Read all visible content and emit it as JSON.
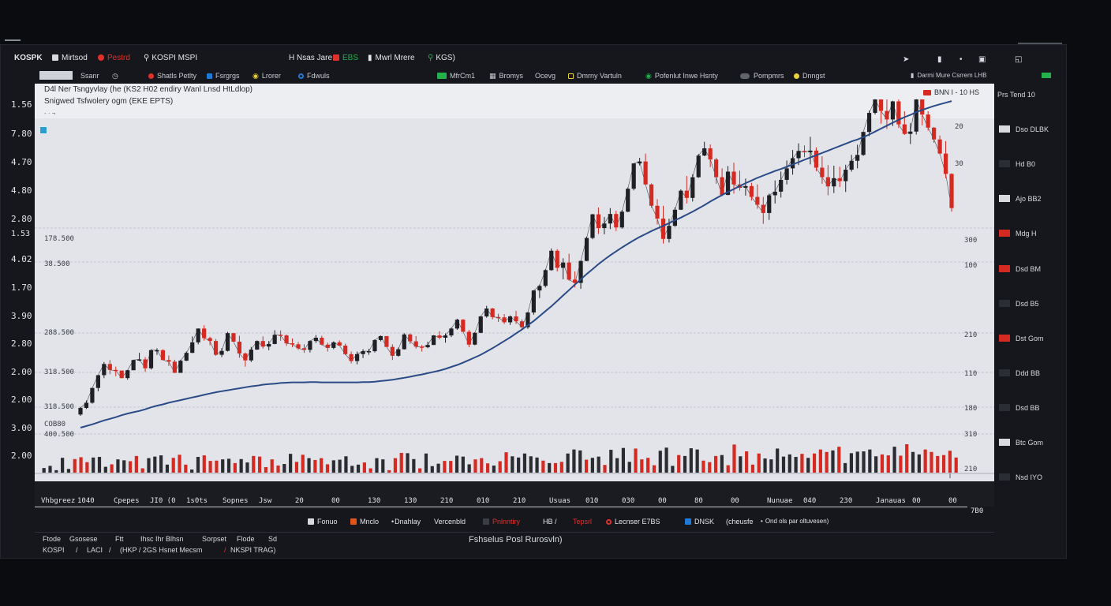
{
  "colors": {
    "up": "#1e2024",
    "down": "#d42a22",
    "ma": "#2b4a86",
    "panel": "#e2e4e9",
    "accent_green": "#22b14c",
    "accent_blue": "#1e7ad6"
  },
  "topbar": {
    "symbol": "KOSPK",
    "items": [
      {
        "label": "Mirtsod",
        "icon": "square-icon",
        "color": "#d6d9de"
      },
      {
        "label": "Pestrd",
        "icon": "record-dot-icon",
        "color": "#e0302a"
      },
      {
        "label": "KOSPI MSPI",
        "icon": "search-icon",
        "color": "#d6d9de"
      },
      {
        "label": "H Nsas Jare",
        "icon": "",
        "color": "#d6d9de"
      },
      {
        "label": "EBS",
        "icon": "red-square-icon",
        "color": "#22b14c"
      },
      {
        "label": "Mwrl Mrere",
        "icon": "candle-icon",
        "color": "#d6d9de"
      },
      {
        "label": "KGS)",
        "icon": "search-icon",
        "color": "#d6d9de"
      }
    ]
  },
  "toolbar": {
    "items": [
      {
        "label": "Ssanr",
        "icon": "",
        "color": "#c9ccd3"
      },
      {
        "label": "Shatls Petlty",
        "icon": "record-dot-icon",
        "color": "#e0302a"
      },
      {
        "label": "Fsrgrgs",
        "icon": "blue-square-icon",
        "color": "#1e7ad6"
      },
      {
        "label": "Lrorer",
        "icon": "eye-icon",
        "color": "#e8d23a"
      },
      {
        "label": "Fdwuls",
        "icon": "ring-icon",
        "color": "#1e7ad6"
      },
      {
        "label": "MfrCm1",
        "icon": "green-square-icon",
        "color": "#22b14c"
      },
      {
        "label": "Bromys",
        "icon": "grid-icon",
        "color": "#c9ccd3"
      },
      {
        "label": "Ocevg",
        "icon": "",
        "color": "#c9ccd3"
      },
      {
        "label": "Dmrny Vartuln",
        "icon": "yellow-square-icon",
        "color": "#e8d23a"
      },
      {
        "label": "Pofenlut Inwe Hsnty",
        "icon": "eye-icon",
        "color": "#22b14c"
      },
      {
        "label": "Pompmrs",
        "icon": "toggle-icon",
        "color": "#888c94"
      },
      {
        "label": "Dnngst",
        "icon": "yellow-dot-icon",
        "color": "#e8d23a"
      },
      {
        "label": "Darmi Mure Csrrem LHB",
        "icon": "",
        "color": "#c9ccd3"
      }
    ]
  },
  "chart_title": {
    "line1": "D4l Ner Tsngyvlay (he (KS2 H02 endiry Wanl Lnsd HtLdlop)",
    "line2": "Snigwed Tsfwolery ogm (EKE EPTS)",
    "tag": "BNN  I - 10 HS"
  },
  "left_axis": [
    "1.56",
    "7.80",
    "4.70",
    "4.80",
    "2.80",
    "1.53",
    "4.02",
    "1.70",
    "3.90",
    "2.80",
    "2.00",
    "2.00",
    "3.00",
    "2.00"
  ],
  "inner_labels": [
    "178.500",
    "38.500",
    "288.500",
    "318.500",
    "318.500",
    "COB80",
    "400.500"
  ],
  "right_axis": [
    "20",
    "30",
    "300",
    "100",
    "210",
    "110",
    "180",
    "310",
    "210"
  ],
  "right_legend": {
    "header": "Prs Tend 10",
    "items": [
      {
        "label": "Dso DLBK",
        "color": "#d8dade"
      },
      {
        "label": "Hd B0",
        "color": "#2a2d33"
      },
      {
        "label": "Ajo BB2",
        "color": "#d8dade"
      },
      {
        "label": "Mdg H",
        "color": "#d42a22"
      },
      {
        "label": "Dsd BM",
        "color": "#d42a22"
      },
      {
        "label": "Dsd B5",
        "color": "#2a2d33"
      },
      {
        "label": "Dst Gom",
        "color": "#d42a22"
      },
      {
        "label": "Ddd BB",
        "color": "#2a2d33"
      },
      {
        "label": "Dsd BB",
        "color": "#2a2d33"
      },
      {
        "label": "Btc Gom",
        "color": "#d8dade"
      },
      {
        "label": "Nsd IYO",
        "color": "#2a2d33"
      }
    ]
  },
  "x_axis": [
    "Vhbgreez",
    "1040",
    "Cpepes",
    "JI0 (0",
    "1s0ts",
    "Sopnes",
    "Jsw",
    "20",
    "00",
    "130",
    "130",
    "210",
    "010",
    "210",
    "Usuas",
    "010",
    "030",
    "00",
    "80",
    "00",
    "Nunuae",
    "040",
    "230",
    "Janauas",
    "00",
    "00"
  ],
  "x_axis_end": "7B0",
  "legend_bar": [
    {
      "label": "Fonuo",
      "icon": "white-square-icon",
      "color": "#d8dade"
    },
    {
      "label": "Mnclo",
      "icon": "orange-square-icon",
      "color": "#e0561a"
    },
    {
      "label": "Dnahlay",
      "icon": "dot-icon",
      "color": "#d8dade"
    },
    {
      "label": "Vercenbld",
      "icon": "",
      "color": "#d8dade"
    },
    {
      "label": "Pnlnntiry",
      "icon": "dark-square-icon",
      "color": "#e0302a"
    },
    {
      "label": "HB  /",
      "icon": "",
      "color": "#d8dade"
    },
    {
      "label": "Tepsrl",
      "icon": "",
      "color": "#e0302a"
    },
    {
      "label": "Lecnser  E7BS",
      "icon": "ring-icon",
      "color": "#d8dade"
    },
    {
      "label": "DNSK",
      "icon": "blue-square-icon",
      "color": "#d8dade"
    },
    {
      "label": "(cheusfe",
      "icon": "",
      "color": "#d8dade"
    },
    {
      "label": "Ond ols par oltuvesen)",
      "icon": "dot-icon",
      "color": "#d8dade"
    }
  ],
  "footer": {
    "row1": [
      "Ftode",
      "Gsosese",
      "Ftt",
      "Ihsc  Ihr Blhsn",
      "Sorpset",
      "Flode",
      "Sd"
    ],
    "row2": [
      "KOSPI",
      "/",
      "LACI",
      "/",
      "(HKP  /  2GS Hsnet  Mecsm",
      "/",
      "NKSPI  TRAG)"
    ],
    "center": "Fshselus Posl Rurosvln)"
  },
  "chart_data": {
    "type": "candlestick",
    "title": "D4l Ner Tsngyvlay (he (KS2 H02 endiry Wanl Lnsd HtLdlop)",
    "subtitle": "Snigwed Tsfwolery ogm (EKE EPTS)",
    "ylim": [
      0,
      100
    ],
    "ohlc": [
      [
        4.0,
        6.3,
        3.6,
        6.0
      ],
      [
        6.0,
        8.3,
        5.7,
        7.6
      ],
      [
        7.6,
        12.1,
        7.3,
        12.1
      ],
      [
        12.1,
        16.0,
        11.1,
        16.0
      ],
      [
        16.0,
        20.0,
        15.1,
        19.4
      ],
      [
        19.4,
        20.6,
        16.3,
        17.6
      ],
      [
        17.6,
        18.6,
        15.7,
        17.4
      ],
      [
        17.4,
        17.4,
        15.1,
        15.1
      ],
      [
        15.1,
        17.6,
        14.6,
        17.5
      ],
      [
        17.5,
        20.7,
        17.5,
        20.6
      ],
      [
        20.6,
        22.8,
        20.3,
        20.8
      ],
      [
        20.8,
        21.5,
        17.0,
        18.1
      ],
      [
        18.1,
        23.9,
        17.7,
        23.6
      ],
      [
        23.6,
        24.2,
        22.2,
        23.6
      ],
      [
        23.6,
        23.9,
        20.6,
        20.6
      ],
      [
        20.6,
        22.0,
        18.8,
        20.1
      ],
      [
        20.1,
        20.7,
        16.7,
        16.7
      ],
      [
        16.7,
        20.7,
        16.7,
        20.4
      ],
      [
        20.4,
        23.2,
        20.3,
        22.8
      ],
      [
        22.8,
        27.8,
        22.7,
        26.0
      ],
      [
        26.0,
        30.2,
        25.4,
        30.2
      ],
      [
        30.2,
        31.2,
        26.5,
        27.3
      ],
      [
        27.3,
        27.7,
        25.1,
        26.4
      ],
      [
        26.4,
        27.0,
        21.9,
        22.2
      ],
      [
        22.2,
        24.2,
        21.5,
        23.4
      ],
      [
        23.4,
        29.2,
        23.2,
        28.8
      ],
      [
        28.8,
        28.8,
        26.2,
        26.2
      ],
      [
        26.2,
        28.0,
        21.3,
        22.6
      ],
      [
        22.6,
        22.9,
        18.6,
        20.5
      ],
      [
        20.5,
        24.6,
        20.0,
        23.8
      ],
      [
        23.8,
        26.6,
        23.7,
        26.4
      ],
      [
        26.4,
        27.8,
        24.1,
        24.7
      ],
      [
        24.7,
        26.4,
        23.6,
        25.5
      ],
      [
        25.5,
        29.7,
        25.4,
        28.3
      ],
      [
        28.3,
        29.6,
        26.5,
        28.1
      ],
      [
        28.1,
        28.4,
        24.9,
        25.7
      ],
      [
        25.7,
        27.2,
        24.5,
        25.4
      ],
      [
        25.4,
        26.1,
        23.7,
        24.2
      ],
      [
        24.2,
        25.4,
        22.8,
        23.7
      ],
      [
        23.7,
        26.6,
        22.9,
        26.4
      ],
      [
        26.4,
        28.2,
        25.8,
        27.4
      ],
      [
        27.4,
        28.0,
        25.1,
        25.3
      ],
      [
        25.3,
        25.9,
        23.2,
        24.3
      ],
      [
        24.3,
        26.3,
        23.9,
        26.0
      ],
      [
        26.0,
        26.6,
        24.9,
        25.0
      ],
      [
        25.0,
        25.6,
        22.1,
        22.4
      ],
      [
        22.4,
        23.2,
        19.6,
        20.3
      ],
      [
        20.3,
        23.2,
        19.3,
        22.4
      ],
      [
        22.4,
        23.9,
        21.2,
        23.3
      ],
      [
        23.3,
        24.0,
        22.2,
        23.3
      ],
      [
        23.3,
        26.9,
        22.9,
        26.7
      ],
      [
        26.7,
        28.1,
        26.3,
        27.9
      ],
      [
        27.9,
        27.9,
        24.6,
        24.6
      ],
      [
        24.6,
        25.4,
        20.6,
        21.9
      ],
      [
        21.9,
        24.4,
        21.6,
        23.9
      ],
      [
        23.9,
        28.8,
        23.8,
        28.4
      ],
      [
        28.4,
        28.7,
        25.5,
        26.3
      ],
      [
        26.3,
        27.9,
        24.1,
        24.7
      ],
      [
        24.7,
        25.2,
        23.2,
        24.5
      ],
      [
        24.5,
        26.2,
        24.2,
        25.2
      ],
      [
        25.2,
        28.2,
        25.2,
        28.1
      ],
      [
        28.1,
        29.4,
        26.9,
        27.4
      ],
      [
        27.4,
        28.7,
        25.9,
        28.1
      ],
      [
        28.1,
        30.5,
        27.6,
        30.2
      ],
      [
        30.2,
        33.2,
        29.8,
        32.9
      ],
      [
        32.9,
        33.1,
        29.2,
        29.2
      ],
      [
        29.2,
        29.8,
        24.5,
        25.3
      ],
      [
        25.3,
        29.1,
        25.1,
        28.9
      ],
      [
        28.9,
        34.0,
        28.8,
        33.9
      ],
      [
        33.9,
        37.1,
        33.5,
        36.3
      ],
      [
        36.3,
        36.5,
        33.0,
        33.7
      ],
      [
        33.7,
        34.7,
        32.2,
        33.6
      ],
      [
        33.6,
        34.6,
        31.6,
        32.1
      ],
      [
        32.1,
        34.2,
        31.3,
        33.9
      ],
      [
        33.9,
        35.6,
        31.6,
        32.4
      ],
      [
        32.4,
        33.0,
        29.7,
        30.6
      ],
      [
        30.6,
        35.2,
        30.1,
        35.1
      ],
      [
        35.1,
        41.8,
        34.4,
        41.8
      ],
      [
        41.8,
        43.6,
        39.5,
        43.2
      ],
      [
        43.2,
        48.3,
        42.7,
        48.0
      ],
      [
        48.0,
        54.6,
        47.8,
        53.9
      ],
      [
        53.9,
        54.4,
        47.6,
        48.7
      ],
      [
        48.7,
        51.6,
        45.2,
        50.3
      ],
      [
        50.3,
        53.0,
        44.8,
        45.1
      ],
      [
        45.1,
        47.6,
        42.7,
        44.1
      ],
      [
        44.1,
        50.9,
        42.3,
        50.8
      ],
      [
        50.8,
        58.2,
        50.7,
        57.8
      ],
      [
        57.8,
        65.1,
        57.4,
        65.0
      ],
      [
        65.0,
        67.1,
        59.0,
        60.8
      ],
      [
        60.8,
        64.2,
        58.9,
        62.2
      ],
      [
        62.2,
        66.9,
        60.5,
        65.1
      ],
      [
        65.1,
        66.1,
        59.9,
        61.0
      ],
      [
        61.0,
        66.3,
        60.6,
        65.8
      ],
      [
        65.8,
        73.2,
        65.6,
        72.8
      ],
      [
        72.8,
        80.5,
        72.3,
        80.5
      ],
      [
        80.5,
        82.2,
        79.9,
        81.1
      ],
      [
        81.1,
        83.5,
        74.0,
        74.1
      ],
      [
        74.1,
        74.4,
        67.0,
        67.6
      ],
      [
        67.6,
        69.6,
        61.9,
        63.7
      ],
      [
        63.7,
        67.6,
        56.1,
        57.5
      ],
      [
        57.5,
        63.7,
        56.4,
        61.5
      ],
      [
        61.5,
        67.1,
        61.2,
        66.4
      ],
      [
        66.4,
        72.6,
        66.3,
        72.2
      ],
      [
        72.2,
        76.7,
        68.3,
        70.0
      ],
      [
        70.0,
        77.2,
        68.9,
        76.3
      ],
      [
        76.3,
        83.4,
        76.1,
        82.9
      ],
      [
        82.9,
        87.1,
        82.7,
        85.1
      ],
      [
        85.1,
        86.3,
        79.4,
        81.7
      ],
      [
        81.7,
        82.2,
        74.3,
        76.3
      ],
      [
        76.3,
        79.0,
        70.5,
        70.9
      ],
      [
        70.9,
        79.7,
        70.8,
        78.0
      ],
      [
        78.0,
        80.7,
        71.3,
        74.1
      ],
      [
        74.1,
        78.3,
        72.2,
        73.1
      ],
      [
        73.1,
        75.9,
        70.7,
        73.6
      ],
      [
        73.6,
        74.6,
        69.2,
        70.3
      ],
      [
        70.3,
        74.1,
        66.7,
        67.9
      ],
      [
        67.9,
        70.3,
        62.1,
        65.4
      ],
      [
        65.4,
        71.3,
        63.3,
        70.8
      ],
      [
        70.8,
        75.3,
        68.3,
        71.9
      ],
      [
        71.9,
        78.0,
        70.1,
        75.5
      ],
      [
        75.5,
        81.4,
        74.1,
        79.0
      ],
      [
        79.0,
        84.6,
        77.1,
        82.1
      ],
      [
        82.1,
        86.6,
        80.0,
        84.3
      ],
      [
        84.3,
        86.0,
        82.4,
        83.9
      ],
      [
        83.9,
        88.6,
        80.2,
        84.4
      ],
      [
        84.4,
        85.4,
        78.1,
        79.2
      ],
      [
        79.2,
        82.7,
        74.3,
        76.3
      ],
      [
        76.3,
        80.0,
        70.8,
        73.5
      ],
      [
        73.5,
        79.8,
        71.5,
        76.0
      ],
      [
        76.0,
        79.5,
        73.3,
        75.1
      ],
      [
        75.1,
        80.1,
        71.8,
        78.6
      ],
      [
        78.6,
        83.1,
        78.0,
        81.3
      ],
      [
        81.3,
        86.2,
        79.0,
        83.1
      ],
      [
        83.1,
        90.1,
        82.8,
        90.1
      ],
      [
        90.1,
        96.6,
        88.8,
        95.9
      ],
      [
        95.9,
        100.0,
        95.4,
        100.0
      ],
      [
        100.0,
        100.0,
        92.6,
        96.5
      ],
      [
        96.5,
        100.0,
        91.0,
        93.9
      ],
      [
        93.9,
        99.6,
        91.9,
        99.4
      ],
      [
        99.4,
        100.0,
        91.3,
        92.4
      ],
      [
        92.4,
        96.4,
        89.2,
        89.5
      ],
      [
        89.5,
        92.8,
        86.4,
        90.2
      ],
      [
        90.2,
        100.0,
        89.3,
        100.0
      ],
      [
        100.0,
        100.0,
        92.1,
        95.4
      ],
      [
        95.4,
        96.4,
        90.5,
        91.4
      ],
      [
        91.4,
        91.6,
        86.8,
        87.8
      ],
      [
        87.8,
        89.0,
        83.3,
        83.5
      ],
      [
        83.5,
        87.3,
        76.0,
        77.3
      ],
      [
        77.3,
        77.5,
        65.8,
        66.9
      ]
    ],
    "moving_average": [
      0.0,
      0.5,
      1.0,
      1.6,
      2.2,
      2.7,
      3.2,
      3.8,
      4.3,
      4.7,
      5.1,
      5.6,
      6.2,
      6.7,
      7.1,
      7.6,
      8.0,
      8.4,
      8.8,
      9.2,
      9.6,
      10.0,
      10.4,
      10.8,
      11.1,
      11.4,
      11.7,
      12.0,
      12.3,
      12.6,
      12.8,
      13.1,
      13.3,
      13.4,
      13.6,
      13.7,
      13.8,
      13.8,
      13.8,
      13.9,
      13.9,
      13.8,
      13.8,
      13.8,
      13.8,
      13.8,
      13.8,
      13.8,
      13.9,
      13.9,
      14.0,
      14.2,
      14.4,
      14.6,
      14.9,
      15.2,
      15.5,
      15.9,
      16.2,
      16.6,
      17.0,
      17.4,
      17.9,
      18.5,
      19.1,
      19.8,
      20.6,
      21.4,
      22.2,
      23.2,
      24.2,
      25.3,
      26.4,
      27.5,
      28.7,
      29.9,
      31.2,
      32.5,
      34.0,
      35.5,
      37.0,
      38.6,
      40.3,
      41.9,
      43.6,
      45.2,
      46.8,
      48.3,
      49.8,
      51.2,
      52.5,
      53.7,
      54.9,
      56.0,
      57.1,
      58.1,
      59.0,
      59.9,
      60.7,
      61.5,
      62.3,
      63.2,
      64.0,
      64.9,
      65.8,
      66.8,
      67.8,
      68.9,
      69.9,
      70.9,
      71.8,
      72.7,
      73.6,
      74.5,
      75.3,
      76.1,
      76.8,
      77.5,
      78.2,
      78.8,
      79.5,
      80.2,
      80.9,
      81.6,
      82.3,
      83.0,
      83.7,
      84.4,
      85.1,
      85.8,
      86.5,
      87.2,
      87.8,
      88.5,
      89.3,
      90.2,
      91.1,
      92.0,
      92.9,
      93.8,
      94.6,
      95.3,
      96.1,
      96.8,
      97.4,
      98.0,
      98.5,
      99.0,
      99.5
    ],
    "volume": [
      15,
      22,
      8,
      48,
      12,
      44,
      50,
      34,
      49,
      51,
      19,
      27,
      43,
      40,
      37,
      54,
      14,
      47,
      52,
      56,
      26,
      48,
      58,
      26,
      10,
      51,
      56,
      38,
      39,
      43,
      45,
      31,
      44,
      33,
      54,
      52,
      18,
      43,
      23,
      28,
      61,
      35,
      58,
      47,
      41,
      47,
      27,
      40,
      42,
      53,
      22,
      26,
      33,
      14,
      47,
      43,
      8,
      47,
      64,
      63,
      44,
      14,
      62,
      21,
      29,
      38,
      38,
      55,
      52,
      27,
      43,
      47,
      30,
      23,
      37,
      66,
      53,
      49,
      62,
      53,
      49,
      39,
      31,
      31,
      35,
      62,
      75,
      72,
      42,
      48,
      52,
      25,
      74,
      47,
      80,
      35,
      78,
      43,
      48,
      24,
      71,
      81,
      22,
      57,
      54,
      79,
      75,
      39,
      34,
      54,
      57,
      24,
      91,
      53,
      69,
      26,
      62,
      46,
      43,
      78,
      52,
      59,
      51,
      61,
      48,
      62,
      75,
      67,
      72,
      84,
      31,
      63,
      68,
      69,
      75,
      53,
      59,
      56,
      84,
      55,
      92,
      67,
      59,
      75,
      67,
      54,
      57,
      71,
      49
    ]
  }
}
